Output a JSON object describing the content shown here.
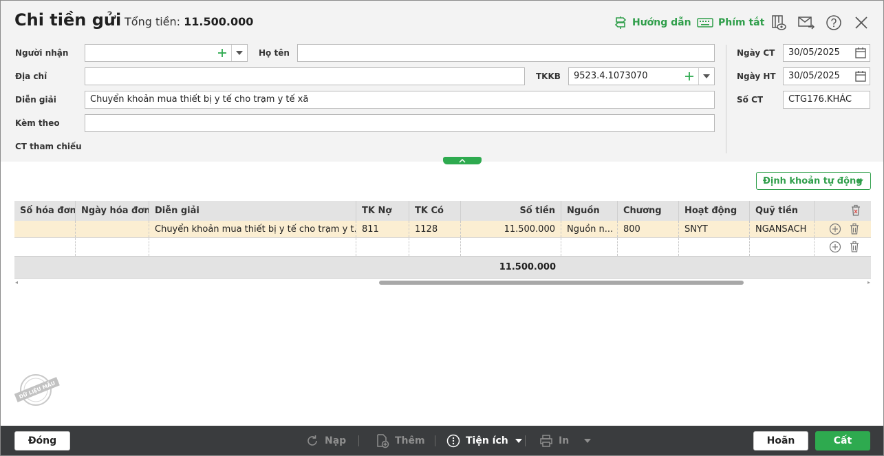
{
  "header": {
    "title": "Chi tiền gửi",
    "total_label": "Tổng tiền:",
    "total_value": "11.500.000",
    "guide_label": "Hướng dẫn",
    "shortcut_label": "Phím tắt"
  },
  "form": {
    "recipient_label": "Người nhận",
    "recipient_value": "",
    "fullname_label": "Họ tên",
    "fullname_value": "",
    "address_label": "Địa chỉ",
    "address_value": "",
    "tkkb_label": "TKKB",
    "tkkb_value": "9523.4.1073070",
    "description_label": "Diễn giải",
    "description_value": "Chuyển khoản mua thiết bị y tế cho trạm y tế xã",
    "attach_label": "Kèm theo",
    "attach_value": "",
    "reference_label": "CT tham chiếu",
    "doc_date_label": "Ngày CT",
    "doc_date_value": "30/05/2025",
    "post_date_label": "Ngày HT",
    "post_date_value": "30/05/2025",
    "doc_no_label": "Số CT",
    "doc_no_value": "CTG176.KHÁC"
  },
  "auto_account_label": "Định khoản tự động",
  "grid": {
    "columns": [
      "Số hóa đơn",
      "Ngày hóa đơn",
      "Diễn giải",
      "TK Nợ",
      "TK Có",
      "Số tiền",
      "Nguồn",
      "Chương",
      "Hoạt động",
      "Quỹ tiền"
    ],
    "rows": [
      [
        "",
        "",
        "Chuyển khoản mua thiết bị y tế cho trạm y t...",
        "811",
        "1128",
        "11.500.000",
        "Nguồn n...",
        "800",
        "SNYT",
        "NGANSACH"
      ],
      [
        "",
        "",
        "",
        "",
        "",
        "",
        "",
        "",
        "",
        ""
      ]
    ],
    "total_amount": "11.500.000"
  },
  "stamp_text": "DỮ LIỆU MẪU",
  "footer": {
    "close_label": "Đóng",
    "reload_label": "Nạp",
    "add_label": "Thêm",
    "utilities_label": "Tiện ích",
    "print_label": "In",
    "cancel_label": "Hoãn",
    "save_label": "Cất"
  },
  "colors": {
    "accent": "#2eaa4f",
    "selected_row": "#fbeed2",
    "footer_bar": "#3a3c3e",
    "form_background": "#f3f3f3"
  }
}
